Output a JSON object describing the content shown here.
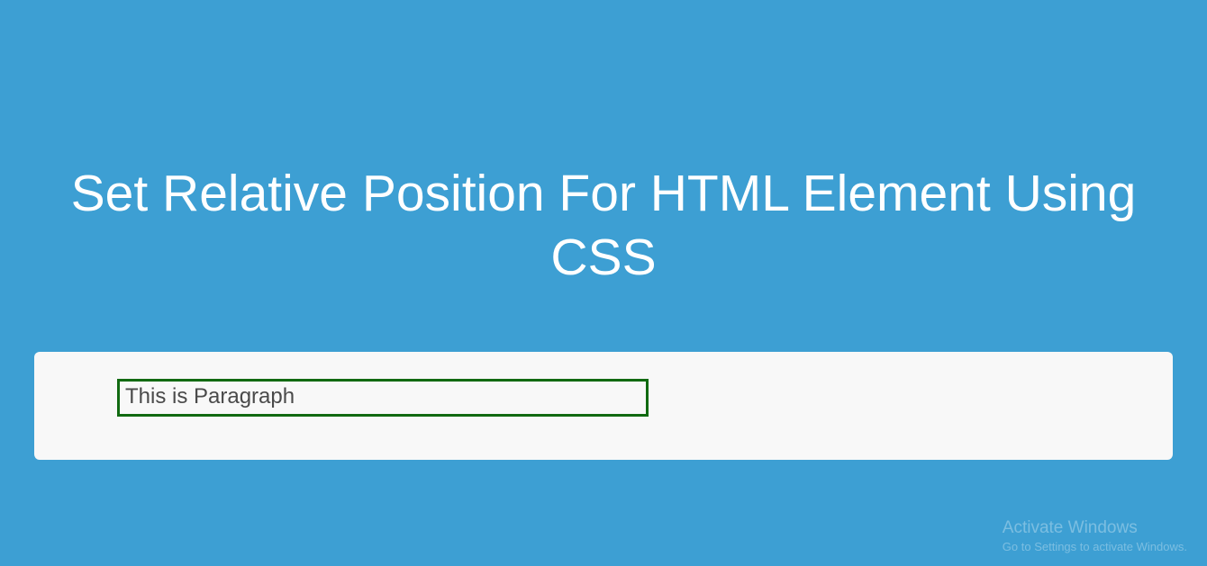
{
  "heading": "Set Relative Position For HTML Element Using CSS",
  "content": {
    "paragraph": "This is Paragraph"
  },
  "watermark": {
    "title": "Activate Windows",
    "subtitle": "Go to Settings to activate Windows."
  },
  "colors": {
    "background": "#3d9fd3",
    "heading_text": "#ffffff",
    "card_bg": "#f8f8f8",
    "box_border": "#116a11",
    "paragraph_text": "#4a4a4a"
  }
}
